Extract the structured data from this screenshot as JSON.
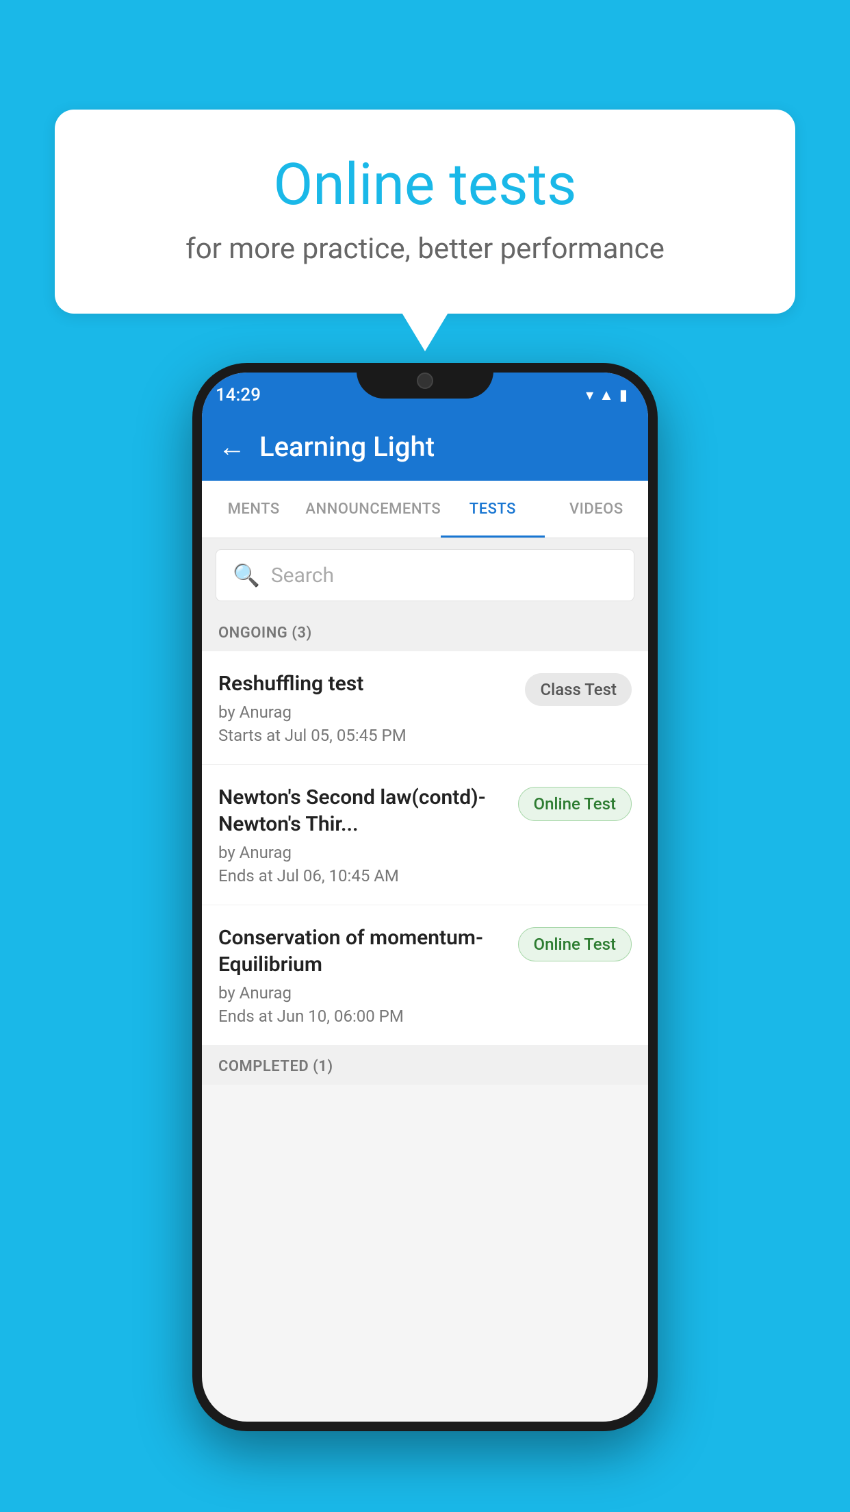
{
  "background_color": "#1ab8e8",
  "speech_bubble": {
    "title": "Online tests",
    "subtitle": "for more practice, better performance"
  },
  "phone": {
    "status_bar": {
      "time": "14:29",
      "icons": [
        "wifi",
        "signal",
        "battery"
      ]
    },
    "app_bar": {
      "back_label": "←",
      "title": "Learning Light"
    },
    "tabs": [
      {
        "label": "MENTS",
        "active": false
      },
      {
        "label": "ANNOUNCEMENTS",
        "active": false
      },
      {
        "label": "TESTS",
        "active": true
      },
      {
        "label": "VIDEOS",
        "active": false
      }
    ],
    "search": {
      "placeholder": "Search"
    },
    "sections": [
      {
        "label": "ONGOING (3)",
        "items": [
          {
            "name": "Reshuffling test",
            "author": "by Anurag",
            "time": "Starts at  Jul 05, 05:45 PM",
            "badge": "Class Test",
            "badge_type": "class"
          },
          {
            "name": "Newton's Second law(contd)-Newton's Thir...",
            "author": "by Anurag",
            "time": "Ends at  Jul 06, 10:45 AM",
            "badge": "Online Test",
            "badge_type": "online"
          },
          {
            "name": "Conservation of momentum-Equilibrium",
            "author": "by Anurag",
            "time": "Ends at  Jun 10, 06:00 PM",
            "badge": "Online Test",
            "badge_type": "online"
          }
        ]
      },
      {
        "label": "COMPLETED (1)",
        "items": []
      }
    ]
  }
}
